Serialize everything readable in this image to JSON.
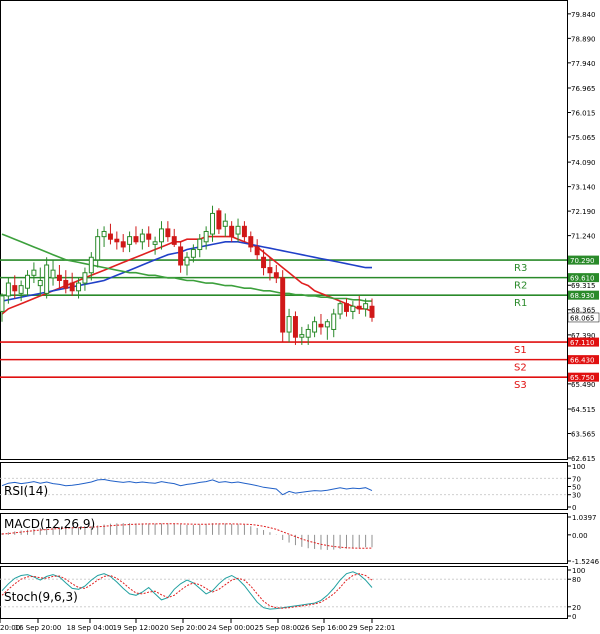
{
  "chart_data": [
    {
      "type": "candlestick",
      "panel": "main",
      "title": "",
      "y_ticks": [
        "79.840",
        "78.890",
        "77.940",
        "76.965",
        "76.015",
        "75.065",
        "74.090",
        "73.140",
        "72.190",
        "71.240",
        "70.290",
        "69.315",
        "68.365",
        "67.390",
        "66.440",
        "65.490",
        "64.515",
        "63.565",
        "62.615"
      ],
      "ylim": [
        62.615,
        80.3
      ],
      "candles": [
        {
          "o": 68.3,
          "h": 69.0,
          "l": 67.9,
          "c": 68.9
        },
        {
          "o": 68.9,
          "h": 69.6,
          "l": 68.6,
          "c": 69.4
        },
        {
          "o": 69.3,
          "h": 69.7,
          "l": 68.8,
          "c": 69.1
        },
        {
          "o": 69.0,
          "h": 69.5,
          "l": 68.7,
          "c": 69.3
        },
        {
          "o": 69.2,
          "h": 69.9,
          "l": 68.9,
          "c": 69.7
        },
        {
          "o": 69.7,
          "h": 70.2,
          "l": 69.4,
          "c": 69.9
        },
        {
          "o": 69.3,
          "h": 70.0,
          "l": 68.9,
          "c": 69.5
        },
        {
          "o": 69.0,
          "h": 70.4,
          "l": 68.8,
          "c": 70.1
        },
        {
          "o": 69.6,
          "h": 70.3,
          "l": 69.3,
          "c": 69.9
        },
        {
          "o": 69.7,
          "h": 70.1,
          "l": 69.2,
          "c": 69.5
        },
        {
          "o": 69.5,
          "h": 69.9,
          "l": 69.0,
          "c": 69.2
        },
        {
          "o": 69.4,
          "h": 69.8,
          "l": 68.9,
          "c": 69.1
        },
        {
          "o": 69.1,
          "h": 69.6,
          "l": 68.8,
          "c": 69.4
        },
        {
          "o": 69.4,
          "h": 70.0,
          "l": 69.1,
          "c": 69.8
        },
        {
          "o": 69.8,
          "h": 70.6,
          "l": 69.5,
          "c": 70.4
        },
        {
          "o": 70.3,
          "h": 71.5,
          "l": 70.0,
          "c": 71.2
        },
        {
          "o": 71.2,
          "h": 71.6,
          "l": 70.8,
          "c": 71.4
        },
        {
          "o": 71.3,
          "h": 71.7,
          "l": 70.9,
          "c": 71.1
        },
        {
          "o": 71.1,
          "h": 71.4,
          "l": 70.7,
          "c": 71.0
        },
        {
          "o": 71.0,
          "h": 71.3,
          "l": 70.6,
          "c": 70.8
        },
        {
          "o": 70.9,
          "h": 71.4,
          "l": 70.6,
          "c": 71.2
        },
        {
          "o": 71.2,
          "h": 71.6,
          "l": 70.9,
          "c": 71.0
        },
        {
          "o": 71.0,
          "h": 71.5,
          "l": 70.7,
          "c": 71.3
        },
        {
          "o": 71.3,
          "h": 71.6,
          "l": 70.8,
          "c": 71.1
        },
        {
          "o": 70.9,
          "h": 71.2,
          "l": 70.5,
          "c": 71.0
        },
        {
          "o": 71.0,
          "h": 71.8,
          "l": 70.7,
          "c": 71.5
        },
        {
          "o": 71.5,
          "h": 71.8,
          "l": 71.0,
          "c": 71.2
        },
        {
          "o": 71.2,
          "h": 71.5,
          "l": 70.8,
          "c": 70.9
        },
        {
          "o": 70.8,
          "h": 71.0,
          "l": 69.8,
          "c": 70.1
        },
        {
          "o": 70.1,
          "h": 70.6,
          "l": 69.7,
          "c": 70.4
        },
        {
          "o": 70.4,
          "h": 70.9,
          "l": 70.2,
          "c": 70.7
        },
        {
          "o": 70.7,
          "h": 71.3,
          "l": 70.4,
          "c": 71.1
        },
        {
          "o": 71.0,
          "h": 71.6,
          "l": 70.7,
          "c": 71.4
        },
        {
          "o": 71.3,
          "h": 72.4,
          "l": 71.0,
          "c": 72.1
        },
        {
          "o": 72.2,
          "h": 72.3,
          "l": 71.3,
          "c": 71.5
        },
        {
          "o": 71.6,
          "h": 72.1,
          "l": 71.2,
          "c": 71.8
        },
        {
          "o": 71.6,
          "h": 71.8,
          "l": 71.0,
          "c": 71.2
        },
        {
          "o": 71.3,
          "h": 71.9,
          "l": 71.0,
          "c": 71.6
        },
        {
          "o": 71.6,
          "h": 71.8,
          "l": 71.0,
          "c": 71.2
        },
        {
          "o": 71.2,
          "h": 71.4,
          "l": 70.6,
          "c": 70.8
        },
        {
          "o": 70.8,
          "h": 71.1,
          "l": 70.3,
          "c": 70.5
        },
        {
          "o": 70.4,
          "h": 70.7,
          "l": 69.7,
          "c": 70.0
        },
        {
          "o": 70.0,
          "h": 70.4,
          "l": 69.5,
          "c": 69.8
        },
        {
          "o": 69.8,
          "h": 70.1,
          "l": 69.4,
          "c": 69.6
        },
        {
          "o": 69.6,
          "h": 69.9,
          "l": 67.1,
          "c": 67.5
        },
        {
          "o": 67.5,
          "h": 68.4,
          "l": 67.1,
          "c": 68.1
        },
        {
          "o": 68.1,
          "h": 68.3,
          "l": 67.0,
          "c": 67.3
        },
        {
          "o": 67.3,
          "h": 67.7,
          "l": 67.0,
          "c": 67.4
        },
        {
          "o": 67.3,
          "h": 67.8,
          "l": 67.0,
          "c": 67.6
        },
        {
          "o": 67.5,
          "h": 68.1,
          "l": 67.3,
          "c": 67.9
        },
        {
          "o": 67.8,
          "h": 68.2,
          "l": 67.4,
          "c": 67.7
        },
        {
          "o": 67.7,
          "h": 68.0,
          "l": 67.2,
          "c": 67.9
        },
        {
          "o": 67.6,
          "h": 68.4,
          "l": 67.3,
          "c": 68.2
        },
        {
          "o": 68.2,
          "h": 68.7,
          "l": 68.0,
          "c": 68.6
        },
        {
          "o": 68.6,
          "h": 68.8,
          "l": 68.1,
          "c": 68.3
        },
        {
          "o": 68.3,
          "h": 68.7,
          "l": 68.0,
          "c": 68.5
        },
        {
          "o": 68.5,
          "h": 68.9,
          "l": 68.2,
          "c": 68.4
        },
        {
          "o": 68.4,
          "h": 68.8,
          "l": 68.1,
          "c": 68.6
        },
        {
          "o": 68.5,
          "h": 68.8,
          "l": 67.9,
          "c": 68.07
        }
      ],
      "moving_averages": [
        {
          "color": "#e02020",
          "values": [
            68.2,
            68.4,
            68.5,
            68.6,
            68.7,
            68.8,
            68.9,
            69.0,
            69.1,
            69.2,
            69.3,
            69.4,
            69.5,
            69.6,
            69.7,
            69.8,
            69.9,
            70.0,
            70.1,
            70.2,
            70.3,
            70.4,
            70.5,
            70.6,
            70.7,
            70.8,
            70.9,
            71.0,
            71.0,
            71.1,
            71.1,
            71.1,
            71.2,
            71.2,
            71.2,
            71.2,
            71.2,
            71.1,
            71.0,
            70.9,
            70.8,
            70.6,
            70.4,
            70.2,
            70.0,
            69.8,
            69.6,
            69.4,
            69.3,
            69.1,
            69.0,
            68.9,
            68.8,
            68.7,
            68.6,
            68.5,
            68.4,
            68.4,
            68.3
          ]
        },
        {
          "color": "#2040c8",
          "values": [
            68.7,
            68.75,
            68.8,
            68.85,
            68.9,
            68.95,
            69.0,
            69.05,
            69.1,
            69.15,
            69.2,
            69.25,
            69.3,
            69.35,
            69.4,
            69.45,
            69.5,
            69.6,
            69.7,
            69.8,
            69.9,
            70.0,
            70.1,
            70.2,
            70.3,
            70.4,
            70.5,
            70.55,
            70.6,
            70.7,
            70.75,
            70.8,
            70.85,
            70.9,
            70.95,
            71.0,
            71.0,
            71.0,
            70.95,
            70.9,
            70.85,
            70.8,
            70.75,
            70.7,
            70.65,
            70.6,
            70.55,
            70.5,
            70.45,
            70.4,
            70.35,
            70.3,
            70.25,
            70.2,
            70.15,
            70.1,
            70.05,
            70.0,
            70.0
          ]
        },
        {
          "color": "#3ca03c",
          "values": [
            71.3,
            71.2,
            71.1,
            71.0,
            70.9,
            70.8,
            70.7,
            70.6,
            70.5,
            70.4,
            70.3,
            70.25,
            70.2,
            70.15,
            70.1,
            70.05,
            70.0,
            69.95,
            69.9,
            69.85,
            69.8,
            69.8,
            69.75,
            69.7,
            69.7,
            69.65,
            69.6,
            69.6,
            69.55,
            69.5,
            69.5,
            69.45,
            69.4,
            69.4,
            69.35,
            69.3,
            69.3,
            69.25,
            69.2,
            69.2,
            69.15,
            69.1,
            69.1,
            69.05,
            69.0,
            69.0,
            68.95,
            68.95,
            68.9,
            68.9,
            68.85,
            68.85,
            68.8,
            68.8,
            68.8,
            68.75,
            68.75,
            68.7,
            68.7
          ]
        }
      ],
      "levels": [
        {
          "name": "R3",
          "value": 70.29,
          "label": "70.290",
          "color": "#2a8a2a"
        },
        {
          "name": "R2",
          "value": 69.61,
          "label": "69.610",
          "color": "#2a8a2a"
        },
        {
          "name": "R1",
          "value": 68.93,
          "label": "68.930",
          "color": "#2a8a2a"
        },
        {
          "name": "S1",
          "value": 67.11,
          "label": "67.110",
          "color": "#e01010"
        },
        {
          "name": "S2",
          "value": 66.43,
          "label": "66.430",
          "color": "#e01010"
        },
        {
          "name": "S3",
          "value": 65.75,
          "label": "65.750",
          "color": "#e01010"
        }
      ],
      "current_price": {
        "value": 68.065,
        "label": "68.065"
      }
    },
    {
      "type": "line",
      "panel": "rsi",
      "title": "RSI(14)",
      "y_ticks": [
        "100",
        "70",
        "50",
        "30",
        "0"
      ],
      "ylim": [
        0,
        100
      ],
      "values": [
        52,
        58,
        60,
        57,
        59,
        62,
        58,
        61,
        57,
        55,
        52,
        53,
        55,
        58,
        61,
        66,
        67,
        64,
        62,
        60,
        62,
        59,
        61,
        59,
        58,
        62,
        59,
        57,
        52,
        55,
        57,
        60,
        62,
        66,
        60,
        62,
        59,
        61,
        58,
        55,
        52,
        48,
        46,
        44,
        30,
        38,
        34,
        36,
        38,
        40,
        39,
        41,
        44,
        47,
        44,
        46,
        45,
        47,
        40
      ],
      "color": "#2060c8"
    },
    {
      "type": "bar",
      "panel": "macd",
      "title": "MACD(12,26,9)",
      "y_ticks": [
        "1.0397",
        "0.00",
        "-1.5246"
      ],
      "ylim": [
        -1.5246,
        1.0397
      ],
      "histogram": [
        0.1,
        0.15,
        0.2,
        0.25,
        0.3,
        0.35,
        0.4,
        0.42,
        0.45,
        0.46,
        0.45,
        0.44,
        0.45,
        0.47,
        0.5,
        0.55,
        0.6,
        0.65,
        0.67,
        0.68,
        0.68,
        0.67,
        0.67,
        0.66,
        0.65,
        0.66,
        0.66,
        0.65,
        0.6,
        0.58,
        0.58,
        0.6,
        0.62,
        0.68,
        0.66,
        0.66,
        0.63,
        0.62,
        0.58,
        0.5,
        0.4,
        0.28,
        0.15,
        0.02,
        -0.3,
        -0.45,
        -0.6,
        -0.7,
        -0.78,
        -0.82,
        -0.86,
        -0.88,
        -0.86,
        -0.82,
        -0.8,
        -0.78,
        -0.76,
        -0.72,
        -0.72
      ],
      "signal": [
        0.05,
        0.08,
        0.12,
        0.16,
        0.2,
        0.24,
        0.28,
        0.31,
        0.34,
        0.37,
        0.39,
        0.41,
        0.42,
        0.43,
        0.45,
        0.47,
        0.5,
        0.53,
        0.56,
        0.58,
        0.6,
        0.62,
        0.63,
        0.64,
        0.64,
        0.65,
        0.65,
        0.65,
        0.64,
        0.63,
        0.62,
        0.62,
        0.62,
        0.63,
        0.64,
        0.64,
        0.64,
        0.63,
        0.62,
        0.6,
        0.56,
        0.5,
        0.42,
        0.32,
        0.18,
        0.04,
        -0.1,
        -0.24,
        -0.36,
        -0.46,
        -0.55,
        -0.62,
        -0.68,
        -0.72,
        -0.75,
        -0.77,
        -0.78,
        -0.78,
        -0.77
      ],
      "bar_color": "#909090",
      "signal_color": "#e02020"
    },
    {
      "type": "line",
      "panel": "stoch",
      "title": "Stoch(9,6,3)",
      "y_ticks": [
        "100",
        "80",
        "20",
        "0"
      ],
      "ylim": [
        0,
        100
      ],
      "series": [
        {
          "color": "#20a0a0",
          "values": [
            55,
            70,
            82,
            88,
            90,
            85,
            78,
            86,
            90,
            85,
            72,
            60,
            58,
            65,
            78,
            88,
            92,
            86,
            74,
            60,
            48,
            45,
            52,
            62,
            48,
            35,
            40,
            58,
            70,
            78,
            72,
            60,
            48,
            55,
            70,
            82,
            88,
            80,
            66,
            48,
            30,
            18,
            15,
            16,
            18,
            20,
            22,
            24,
            26,
            28,
            34,
            45,
            60,
            78,
            92,
            96,
            90,
            78,
            62
          ]
        },
        {
          "color": "#e02020",
          "values": [
            45,
            58,
            70,
            80,
            85,
            86,
            83,
            82,
            86,
            87,
            80,
            70,
            62,
            60,
            68,
            78,
            86,
            88,
            82,
            72,
            60,
            50,
            48,
            52,
            54,
            46,
            40,
            45,
            56,
            66,
            72,
            68,
            60,
            52,
            58,
            68,
            78,
            82,
            78,
            65,
            48,
            32,
            22,
            18,
            17,
            18,
            20,
            22,
            24,
            26,
            30,
            38,
            48,
            62,
            78,
            88,
            92,
            88,
            78
          ]
        }
      ]
    }
  ],
  "x_axis": {
    "tick_labels": [
      "20:00",
      "16 Sep 20:00",
      "18 Sep 04:00",
      "19 Sep 12:00",
      "20 Sep 20:00",
      "24 Sep 00:00",
      "25 Sep 08:00",
      "26 Sep 16:00",
      "29 Sep 22:01"
    ]
  },
  "colors": {
    "background": "#ffffff",
    "axis": "#000000",
    "grid": "#d8d8d8",
    "bull_candle": "#2a8a2a",
    "bear_candle": "#d01818",
    "resistance": "#2a8a2a",
    "support": "#e01010"
  }
}
